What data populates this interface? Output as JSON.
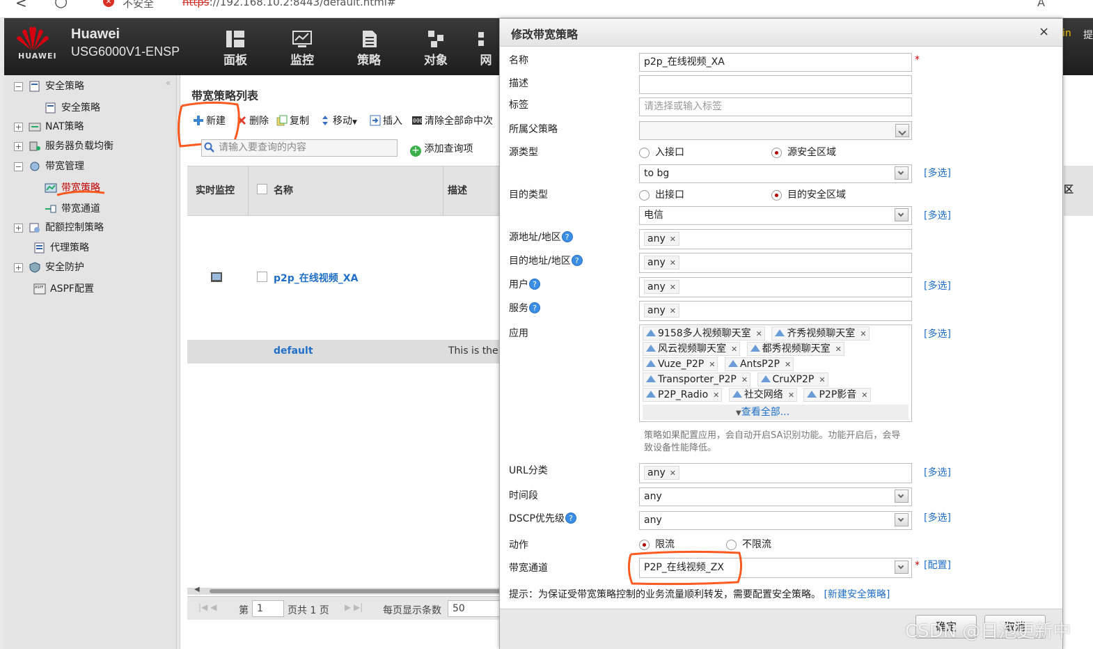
{
  "browser": {
    "warn_icon": "warning-icon",
    "security_label": "不安全",
    "url_scheme": "https",
    "url_rest": "://192.168.10.2:8443/default.html#"
  },
  "header": {
    "logo_text": "HUAWEI",
    "brand": "Huawei",
    "model": "USG6000V1-ENSP",
    "nav": [
      {
        "label": "面板",
        "icon": "dashboard-icon"
      },
      {
        "label": "监控",
        "icon": "monitor-icon"
      },
      {
        "label": "策略",
        "icon": "policy-icon"
      },
      {
        "label": "对象",
        "icon": "object-icon"
      },
      {
        "label": "网",
        "icon": "network-icon"
      }
    ],
    "right_fragment_1": "in",
    "right_fragment_2": "提"
  },
  "sidebar": {
    "items": [
      {
        "label": "安全策略"
      },
      {
        "label": "安全策略"
      },
      {
        "label": "NAT策略"
      },
      {
        "label": "服务器负载均衡"
      },
      {
        "label": "带宽管理"
      },
      {
        "label": "带宽策略"
      },
      {
        "label": "带宽通道"
      },
      {
        "label": "配额控制策略"
      },
      {
        "label": "代理策略"
      },
      {
        "label": "安全防护"
      },
      {
        "label": "ASPF配置"
      }
    ]
  },
  "main": {
    "title": "带宽策略列表",
    "toolbar": {
      "new": "新建",
      "delete": "删除",
      "copy": "复制",
      "move": "移动",
      "insert": "插入",
      "clear": "清除全部命中次"
    },
    "search_placeholder": "请输入要查询的内容",
    "add_query": "添加查询项",
    "columns": {
      "monitor": "实时监控",
      "name": "名称",
      "desc": "描述"
    },
    "rows": [
      {
        "name": "p2p_在线视频_XA",
        "desc": ""
      },
      {
        "name": "default",
        "desc": "This is the"
      }
    ],
    "pager": {
      "page_prefix": "第",
      "page_value": "1",
      "page_total": "页共 1 页",
      "per_page_label": "每页显示条数",
      "per_page_value": "50"
    },
    "right_col_fragment": "区"
  },
  "dialog": {
    "title": "修改带宽策略",
    "close": "×",
    "fields": {
      "name_label": "名称",
      "name_value": "p2p_在线视频_XA",
      "desc_label": "描述",
      "desc_value": "",
      "tag_label": "标签",
      "tag_placeholder": "请选择或输入标签",
      "parent_label": "所属父策略",
      "src_type_label": "源类型",
      "src_type_opt1": "入接口",
      "src_type_opt2": "源安全区域",
      "src_zone_value": "to bg",
      "dst_type_label": "目的类型",
      "dst_type_opt1": "出接口",
      "dst_type_opt2": "目的安全区域",
      "dst_zone_value": "电信",
      "src_addr_label": "源地址/地区",
      "src_addr_tag": "any",
      "dst_addr_label": "目的地址/地区",
      "dst_addr_tag": "any",
      "user_label": "用户",
      "user_tag": "any",
      "service_label": "服务",
      "service_tag": "any",
      "app_label": "应用",
      "apps": [
        "9158多人视频聊天室",
        "齐秀视频聊天室",
        "风云视频聊天室",
        "都秀视频聊天室",
        "Vuze_P2P",
        "AntsP2P",
        "Transporter_P2P",
        "CruXP2P",
        "P2P_Radio",
        "社交网络",
        "P2P影音"
      ],
      "view_all": "查看全部...",
      "app_note": "策略如果配置应用，会自动开启SA识别功能。功能开启后，会导致设备性能降低。",
      "url_label": "URL分类",
      "url_tag": "any",
      "time_label": "时间段",
      "time_value": "any",
      "dscp_label": "DSCP优先级",
      "dscp_value": "any",
      "action_label": "动作",
      "action_opt1": "限流",
      "action_opt2": "不限流",
      "channel_label": "带宽通道",
      "channel_value": "P2P_在线视频_ZX",
      "config_link": "[配置]",
      "multi_link": "[多选]",
      "hint": "提示：为保证受带宽策略控制的业务流量顺利转发，需要配置安全策略。",
      "hint_link": "[新建安全策略]"
    },
    "buttons": {
      "ok": "确定",
      "cancel": "取消"
    }
  },
  "watermark": "CSDN @日泡更新中",
  "colors": {
    "header_bg": "#2a2a2a",
    "link": "#1f6fc9",
    "required": "#d00000",
    "annotation": "#ff5a1f"
  }
}
